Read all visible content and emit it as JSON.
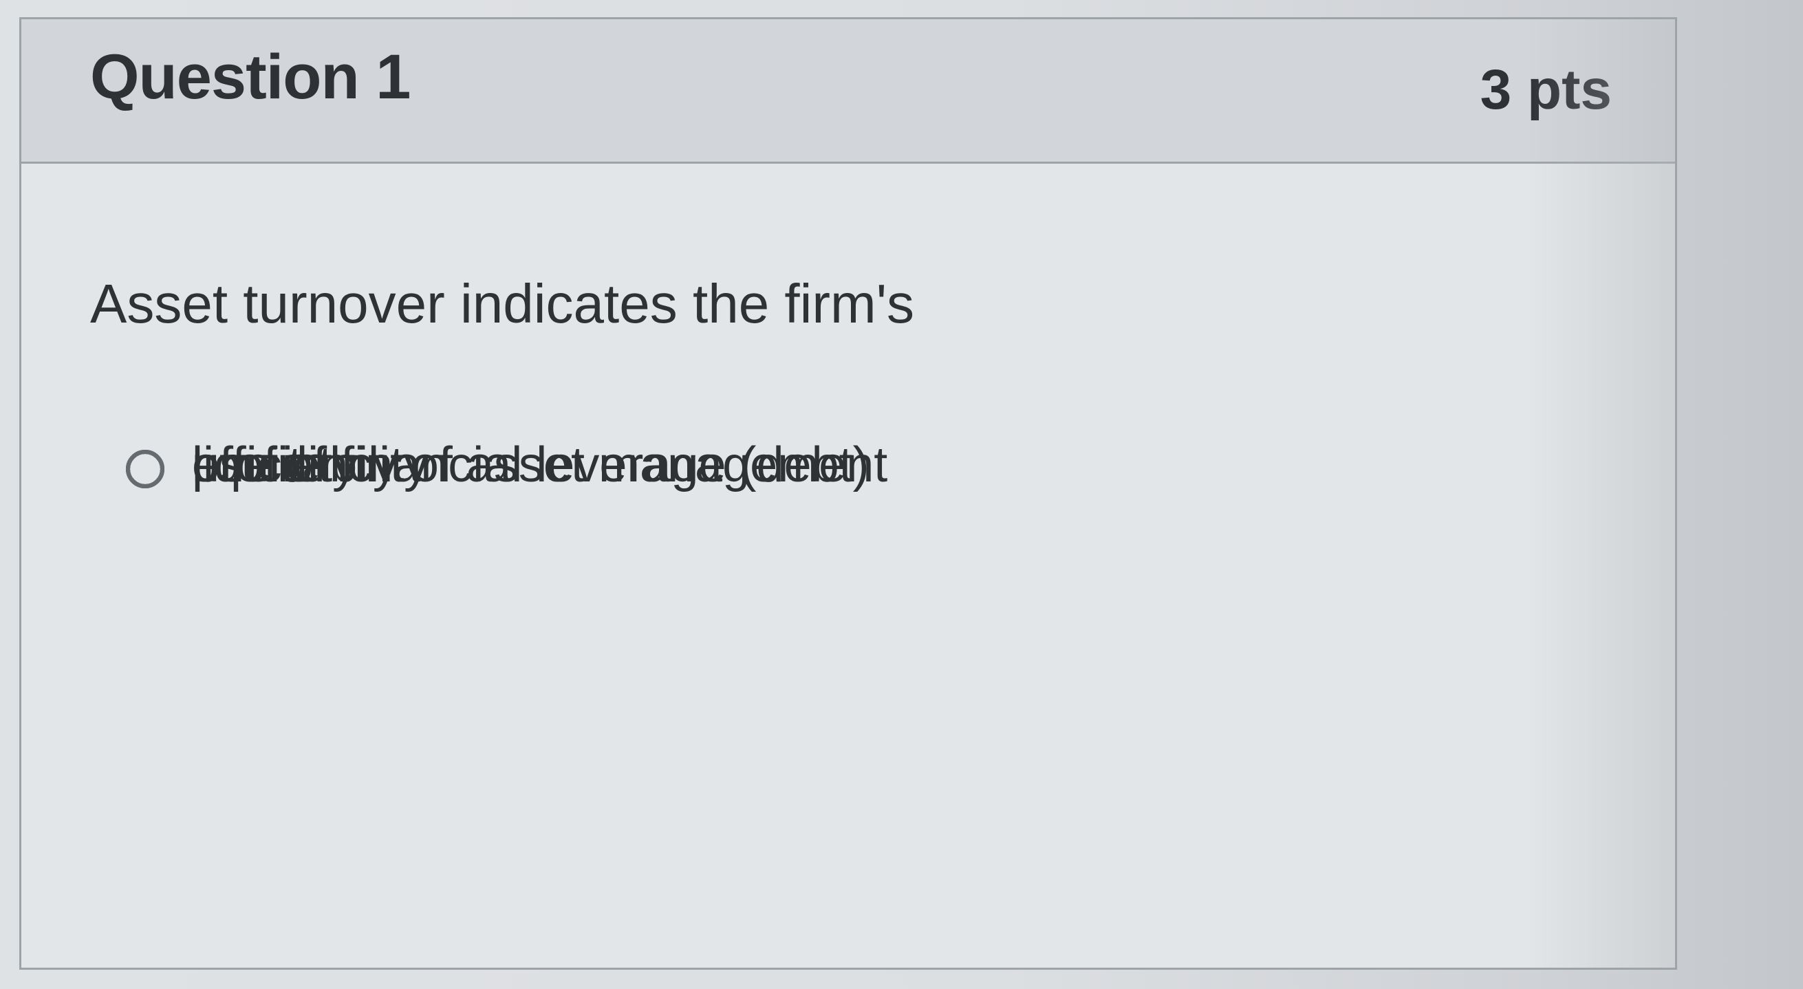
{
  "question": {
    "title": "Question 1",
    "points": "3 pts",
    "prompt": "Asset turnover indicates the firm's"
  },
  "answers": [
    {
      "label": "liquidity",
      "selected": false
    },
    {
      "label": "use of financial leverage (debt)",
      "selected": false
    },
    {
      "label": "profitability",
      "selected": false
    },
    {
      "label": "efficiency of asset management",
      "selected": false
    }
  ],
  "colors": {
    "header_background": "#d2d6da",
    "card_background": "#e3e6e8",
    "border": "#9ea3a8",
    "text": "#2f3235",
    "radio_border": "#666b70"
  },
  "icons": {
    "unselected_radio": "radio-button-icon"
  }
}
